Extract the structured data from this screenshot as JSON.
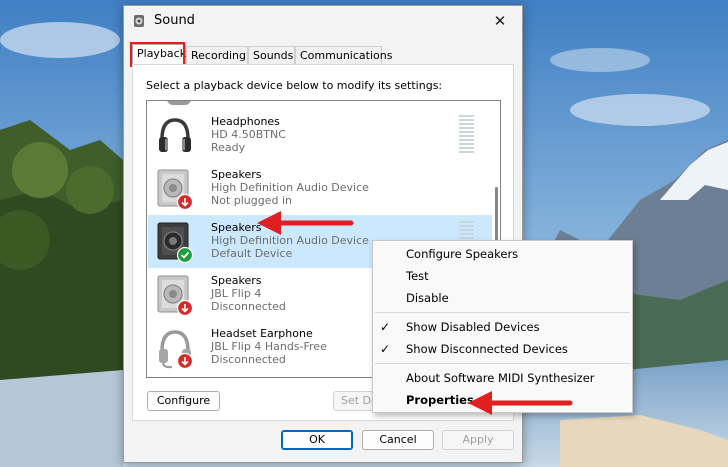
{
  "window": {
    "title": "Sound"
  },
  "tabs": [
    {
      "label": "Playback",
      "active": true
    },
    {
      "label": "Recording"
    },
    {
      "label": "Sounds"
    },
    {
      "label": "Communications"
    }
  ],
  "instruction": "Select a playback device below to modify its settings:",
  "devices": [
    {
      "name": "Headphones",
      "description": "HD 4.50BTNC",
      "status": "Ready",
      "icon": "headphones-icon"
    },
    {
      "name": "Speakers",
      "description": "High Definition Audio Device",
      "status": "Not plugged in",
      "icon": "speaker-icon",
      "badge": "red-down-arrow"
    },
    {
      "name": "Speakers",
      "description": "High Definition Audio Device",
      "status": "Default Device",
      "icon": "speaker-icon",
      "badge": "green-check",
      "selected": true
    },
    {
      "name": "Speakers",
      "description": "JBL Flip 4",
      "status": "Disconnected",
      "icon": "speaker-icon",
      "badge": "red-down-arrow"
    },
    {
      "name": "Headset Earphone",
      "description": "JBL Flip 4 Hands-Free",
      "status": "Disconnected",
      "icon": "headset-icon",
      "badge": "red-down-arrow"
    }
  ],
  "buttons": {
    "configure": "Configure",
    "set_default": "Set De",
    "ok": "OK",
    "cancel": "Cancel",
    "apply": "Apply"
  },
  "context_menu": {
    "items": [
      {
        "label": "Configure Speakers"
      },
      {
        "label": "Test"
      },
      {
        "label": "Disable"
      },
      {
        "label": "Show Disabled Devices",
        "checked": true
      },
      {
        "label": "Show Disconnected Devices",
        "checked": true
      },
      {
        "label": "About Software MIDI Synthesizer"
      },
      {
        "label": "Properties",
        "bold": true
      }
    ],
    "check_glyph": "✓"
  },
  "colors": {
    "accent": "#0067c0",
    "selection": "#cce8ff",
    "annotation_red": "#e02020",
    "status_green": "#1e9e3c",
    "status_red": "#d42b2b"
  }
}
